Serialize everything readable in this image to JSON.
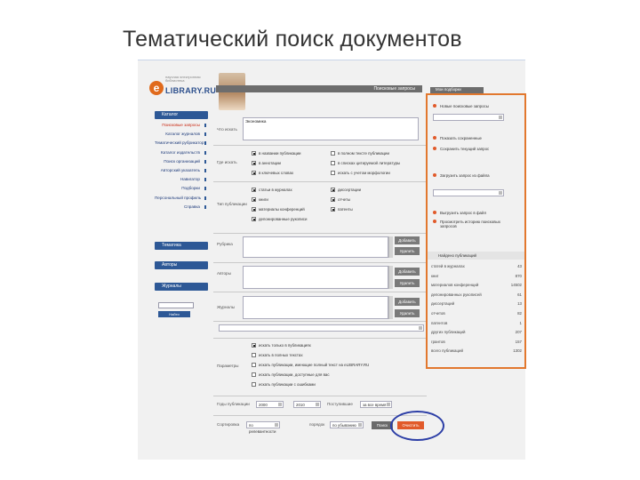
{
  "slide": {
    "title": "Тематический поиск документов"
  },
  "logo": {
    "small": "научная электронная библиотека",
    "big": "LIBRARY.RU",
    "letter": "e"
  },
  "sidebar": {
    "section1": "Каталог",
    "items": [
      {
        "label": "Поисковые запросы",
        "active": true
      },
      {
        "label": "Каталог журналов"
      },
      {
        "label": "Тематический рубрикатор"
      },
      {
        "label": "Каталог издательств"
      },
      {
        "label": "Поиск организаций"
      },
      {
        "label": "Авторский указатель"
      },
      {
        "label": "Навигатор"
      },
      {
        "label": "Подборки"
      },
      {
        "label": "Персональный профиль"
      },
      {
        "label": "Справка"
      }
    ],
    "section2": "Тематика",
    "section3": "Авторы",
    "section4": "Журналы",
    "search_button": "Найти"
  },
  "topbar": {
    "label": "Поисковые запросы"
  },
  "form": {
    "what_label": "Что искать",
    "what_value": "Экономика",
    "where_label": "Где искать",
    "where_options": [
      {
        "label": "в названии публикации",
        "checked": true
      },
      {
        "label": "в аннотации",
        "checked": true
      },
      {
        "label": "в ключевых словах",
        "checked": true
      },
      {
        "label": "в полном тексте публикации",
        "checked": false
      },
      {
        "label": "в списках цитируемой литературы",
        "checked": false
      },
      {
        "label": "искать с учетом морфологии",
        "checked": false
      }
    ],
    "type_label": "Тип публикации",
    "type_options": [
      {
        "label": "статьи в журналах",
        "checked": true
      },
      {
        "label": "книги",
        "checked": true
      },
      {
        "label": "материалы конференций",
        "checked": true
      },
      {
        "label": "депонированные рукописи",
        "checked": true
      },
      {
        "label": "диссертации",
        "checked": true
      },
      {
        "label": "отчеты",
        "checked": true
      },
      {
        "label": "патенты",
        "checked": true
      }
    ],
    "topic_label": "Рубрика",
    "author_label": "Авторы",
    "journal_label": "Журналы",
    "add_button": "Добавить",
    "remove_button": "Удалить",
    "params_label": "Параметры",
    "params_options": [
      {
        "label": "искать только в публикациях",
        "checked": true
      },
      {
        "label": "искать в полных текстах",
        "checked": false
      },
      {
        "label": "искать публикации, имеющие полный текст на eLIBRARY.RU",
        "checked": false
      },
      {
        "label": "искать публикации, доступные для вас",
        "checked": false
      },
      {
        "label": "искать публикации с ошибками",
        "checked": false
      }
    ],
    "years_label": "Годы публикации",
    "year_from": "2000",
    "year_to": "2010",
    "sort_label": "Сортировка",
    "sort_value": "по релевантности",
    "order_label": "порядок",
    "order_value": "по убыванию",
    "updated_label": "Поступившие",
    "updated_value": "за все время",
    "search_button": "Поиск",
    "reset_button": "Очистить"
  },
  "right_panel": {
    "header": "Мои подборки",
    "items": [
      "Новые поисковые запросы",
      "Показать сохраненные",
      "Сохранить текущий запрос",
      "Загрузить запрос из файла",
      "Выгрузить запрос в файл",
      "Просмотреть историю поисковых запросов"
    ],
    "results_header": "Найдено публикаций",
    "stats": [
      {
        "label": "статей в журналах",
        "value": "43"
      },
      {
        "label": "книг",
        "value": "870"
      },
      {
        "label": "материалов конференций",
        "value": "14502"
      },
      {
        "label": "депонированных рукописей",
        "value": "61"
      },
      {
        "label": "диссертаций",
        "value": "13"
      },
      {
        "label": "отчетов",
        "value": "82"
      },
      {
        "label": "патентов",
        "value": "1"
      },
      {
        "label": "других публикаций",
        "value": "207"
      },
      {
        "label": "грантов",
        "value": "157"
      },
      {
        "label": "всего публикаций",
        "value": "1302"
      }
    ]
  }
}
